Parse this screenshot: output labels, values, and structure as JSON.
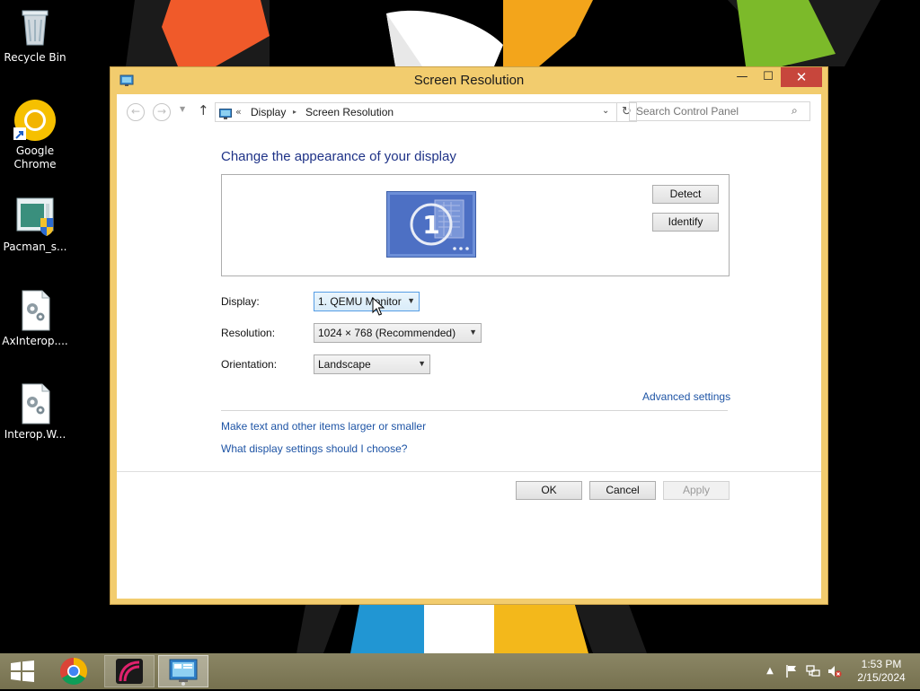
{
  "desktop": {
    "icons": [
      {
        "label": "Recycle Bin"
      },
      {
        "label": "Google Chrome"
      },
      {
        "label": "Pacman_s..."
      },
      {
        "label": "AxInterop...."
      },
      {
        "label": "Interop.W..."
      }
    ]
  },
  "window": {
    "title": "Screen Resolution",
    "controls": {
      "minimize": "—",
      "maximize": "☐",
      "close": "✕"
    }
  },
  "address_bar": {
    "prefix": "«",
    "breadcrumbs": [
      "Display",
      "Screen Resolution"
    ],
    "separator": "▸",
    "search_placeholder": "Search Control Panel"
  },
  "main": {
    "heading": "Change the appearance of your display",
    "monitor_number": "1",
    "detect_label": "Detect",
    "identify_label": "Identify",
    "display_label": "Display:",
    "display_value": "1. QEMU Monitor",
    "resolution_label": "Resolution:",
    "resolution_value": "1024 × 768 (Recommended)",
    "orientation_label": "Orientation:",
    "orientation_value": "Landscape",
    "advanced_link": "Advanced settings",
    "link_text_size": "Make text and other items larger or smaller",
    "link_help": "What display settings should I choose?"
  },
  "footer": {
    "ok": "OK",
    "cancel": "Cancel",
    "apply": "Apply"
  },
  "taskbar": {
    "time": "1:53 PM",
    "date": "2/15/2024"
  },
  "colors": {
    "window_frame": "#f2cc6e",
    "close_button": "#c7463c",
    "heading": "#1e3287",
    "link": "#1e54a5",
    "taskbar": "#7f7a5a"
  }
}
